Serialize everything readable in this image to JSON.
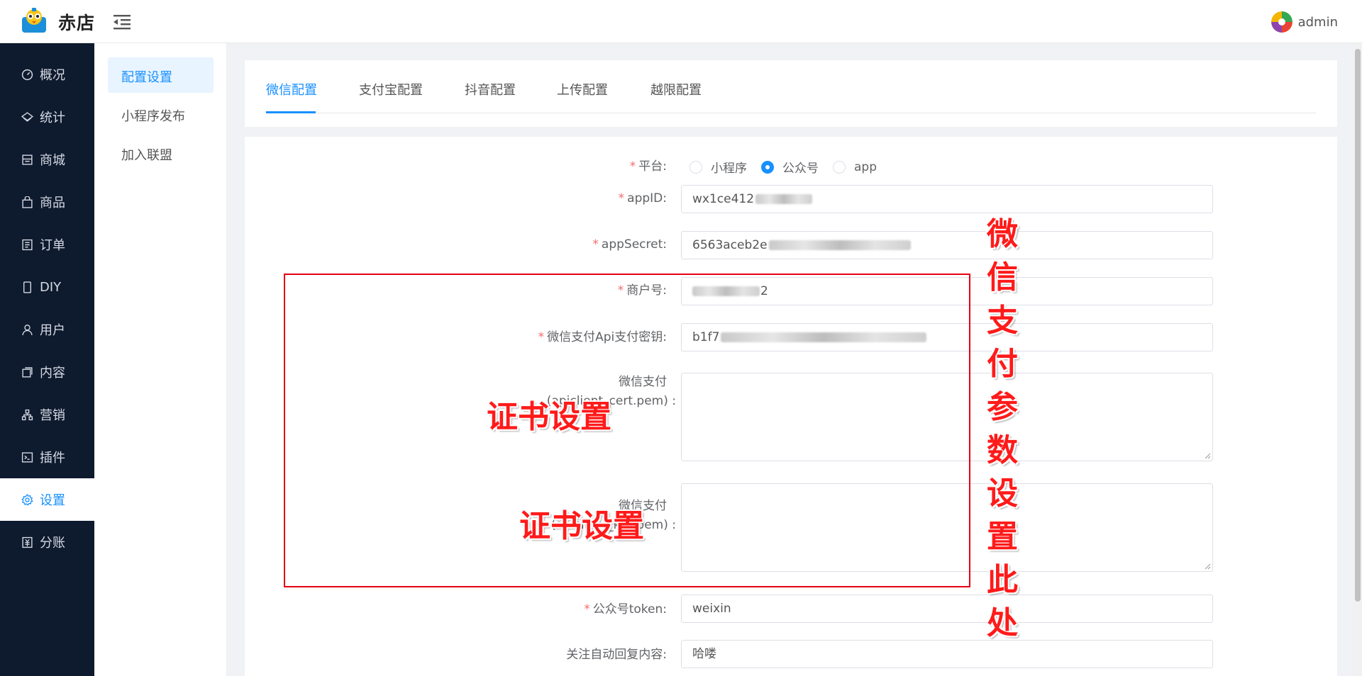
{
  "header": {
    "brand": "赤店",
    "username": "admin"
  },
  "sidenav": {
    "items": [
      {
        "label": "概况",
        "icon": "dashboard-icon"
      },
      {
        "label": "统计",
        "icon": "stats-icon"
      },
      {
        "label": "商城",
        "icon": "store-icon"
      },
      {
        "label": "商品",
        "icon": "bag-icon"
      },
      {
        "label": "订单",
        "icon": "order-icon"
      },
      {
        "label": "DIY",
        "icon": "mobile-icon"
      },
      {
        "label": "用户",
        "icon": "user-icon"
      },
      {
        "label": "内容",
        "icon": "content-icon"
      },
      {
        "label": "营销",
        "icon": "marketing-icon"
      },
      {
        "label": "插件",
        "icon": "plugin-icon"
      },
      {
        "label": "设置",
        "icon": "gear-icon"
      },
      {
        "label": "分账",
        "icon": "ledger-icon"
      }
    ],
    "active": "设置"
  },
  "subnav": {
    "items": [
      "配置设置",
      "小程序发布",
      "加入联盟"
    ],
    "active": "配置设置"
  },
  "tabs": {
    "items": [
      "微信配置",
      "支付宝配置",
      "抖音配置",
      "上传配置",
      "越限配置"
    ],
    "active": "微信配置"
  },
  "form": {
    "platform": {
      "label": "平台:",
      "options": [
        "小程序",
        "公众号",
        "app"
      ],
      "selected": "公众号"
    },
    "appid": {
      "label": "appID:",
      "value_visible": "wx1ce412"
    },
    "appsecret": {
      "label": "appSecret:",
      "value_visible": "6563aceb2e"
    },
    "mchid": {
      "label": "商户号:",
      "value_visible": "2"
    },
    "apikey": {
      "label": "微信支付Api支付密钥:",
      "value_visible": "b1f7"
    },
    "cert": {
      "label_line1": "微信支付",
      "label_line2": "(apiclient_cert.pem) :"
    },
    "key": {
      "label_line1": "微信支付",
      "label_line2": "(apiclient_key.pem) :"
    },
    "token": {
      "label": "公众号token:",
      "value": "weixin"
    },
    "autoreply": {
      "label": "关注自动回复内容:",
      "value": "哈喽"
    }
  },
  "annotations": {
    "cert_note": "证书设置",
    "key_note": "证书设置",
    "vertical_note": [
      "微",
      "信",
      "支",
      "付",
      "参",
      "数",
      "设",
      "置",
      "此",
      "处"
    ],
    "color": "#ff1a1a"
  },
  "colors": {
    "primary": "#1890ff",
    "sidebar_bg": "#0e1a2e",
    "required": "#f56c6c"
  }
}
